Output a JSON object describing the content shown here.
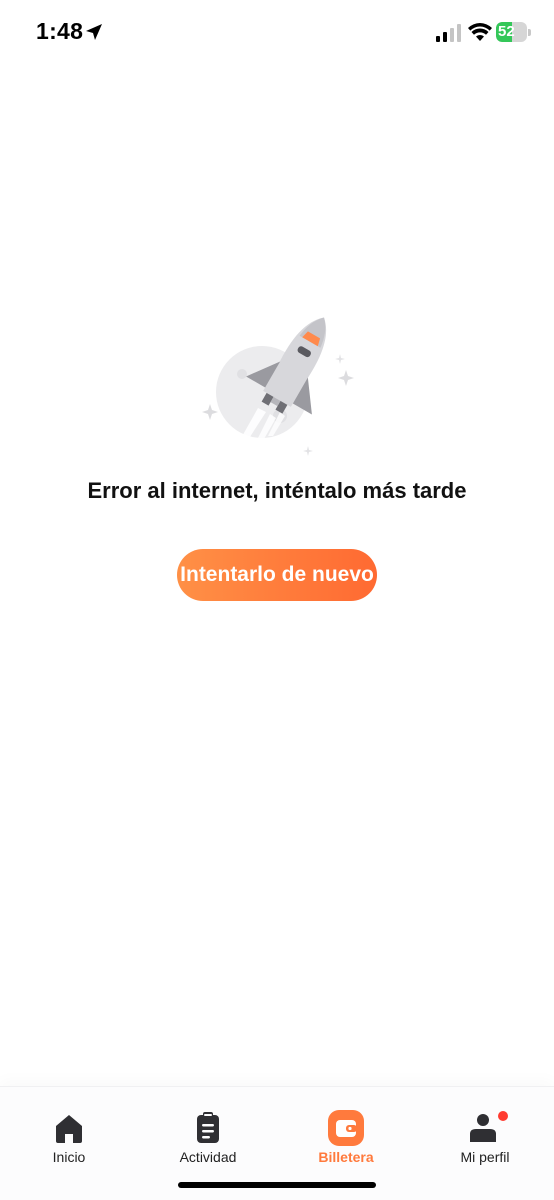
{
  "status_bar": {
    "time": "1:48",
    "battery_percent": "52",
    "battery_level": 0.52,
    "icons": [
      "location-arrow-icon",
      "cellular-signal-icon",
      "wifi-icon",
      "battery-charging-icon"
    ]
  },
  "main": {
    "illustration": "rocket-launch-icon",
    "error_message": "Error al internet, inténtalo más tarde",
    "retry_button_label": "Intentarlo de nuevo"
  },
  "tab_bar": {
    "active_tab": "Billetera",
    "tabs": [
      {
        "label": "Inicio",
        "icon": "home-icon"
      },
      {
        "label": "Actividad",
        "icon": "clipboard-icon"
      },
      {
        "label": "Billetera",
        "icon": "wallet-icon"
      },
      {
        "label": "Mi perfil",
        "icon": "user-icon",
        "notification_dot": true
      }
    ]
  },
  "colors": {
    "accent": "#ff7a3d",
    "button_gradient_start": "#ff9046",
    "button_gradient_end": "#ff6a32",
    "battery_green": "#34c759",
    "notification_dot": "#ff3b30",
    "icon_dark": "#2f2f33"
  }
}
